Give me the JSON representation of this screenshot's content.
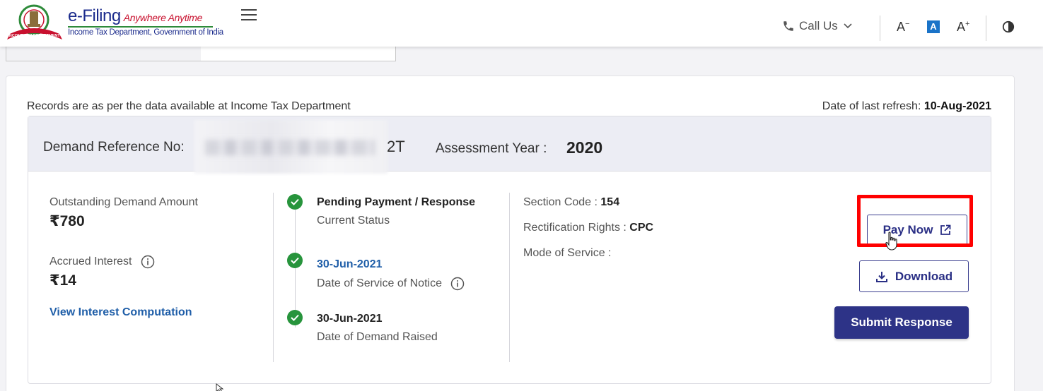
{
  "header": {
    "brand_title": "e-Filing",
    "brand_tagline": "Anywhere Anytime",
    "brand_subtitle": "Income Tax Department, Government of India",
    "call_us": "Call Us",
    "font_decrease": "A",
    "font_normal": "A",
    "font_increase": "A",
    "logo_text": "INCOME TAX DEPARTMENT"
  },
  "records_note": "Records are as per the data available at Income Tax Department",
  "refresh": {
    "label": "Date of last refresh:",
    "value": "10-Aug-2021"
  },
  "demand": {
    "ref_label": "Demand Reference No:",
    "ref_visible_tail": "2T",
    "ay_label": "Assessment Year :",
    "ay_value": "2020"
  },
  "amounts": {
    "outstanding_label": "Outstanding Demand Amount",
    "outstanding_value": "₹780",
    "interest_label": "Accrued Interest",
    "interest_value": "₹14",
    "view_interest_link": "View Interest Computation"
  },
  "status": [
    {
      "title": "Pending Payment / Response",
      "sub": "Current Status"
    },
    {
      "title": "30-Jun-2021",
      "sub": "Date of Service of Notice"
    },
    {
      "title": "30-Jun-2021",
      "sub": "Date of Demand Raised"
    }
  ],
  "details": {
    "section_label": "Section Code :",
    "section_value": "154",
    "rect_label": "Rectification Rights :",
    "rect_value": "CPC",
    "mode_label": "Mode of Service :"
  },
  "actions": {
    "pay_now": "Pay Now",
    "download": "Download",
    "submit_response": "Submit Response"
  },
  "colors": {
    "brand_blue": "#1b2b8c",
    "primary_button": "#2d3387",
    "success_green": "#27943c",
    "link_blue": "#1f5ea8",
    "highlight_red": "#ff0000"
  }
}
